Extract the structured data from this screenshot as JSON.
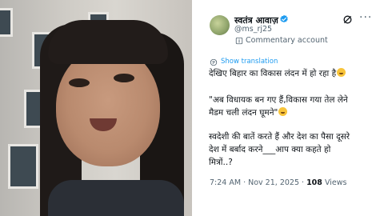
{
  "account": {
    "name": "स्वतंत्र आवाज़",
    "handle": "@ms_rj25",
    "label": "Commentary account"
  },
  "tweet": {
    "show_translation": "Show translation",
    "lines": [
      "देखिए बिहार का विकास लंदन में हो रहा है",
      "\"अब विधायक बन गए हैं,विकास गया तेल लेने",
      "मैडम चली लंदन घूमने\"",
      "स्वदेशी की बातें करते हैं और देश का पैसा दूसरे",
      "देश में बर्बाद करने___आप क्या कहते हो",
      "मित्रों..?"
    ],
    "time": "7:24 AM",
    "date": "Nov 21, 2025",
    "views_count": "108",
    "views_label": "Views"
  },
  "icons": {
    "verified": "verified-badge-icon",
    "grok": "grok-icon",
    "more": "more-icon",
    "commentary": "info-icon",
    "translate": "translate-icon"
  },
  "colors": {
    "accent": "#1d9bf0",
    "muted": "#536471",
    "text": "#0f1419"
  }
}
